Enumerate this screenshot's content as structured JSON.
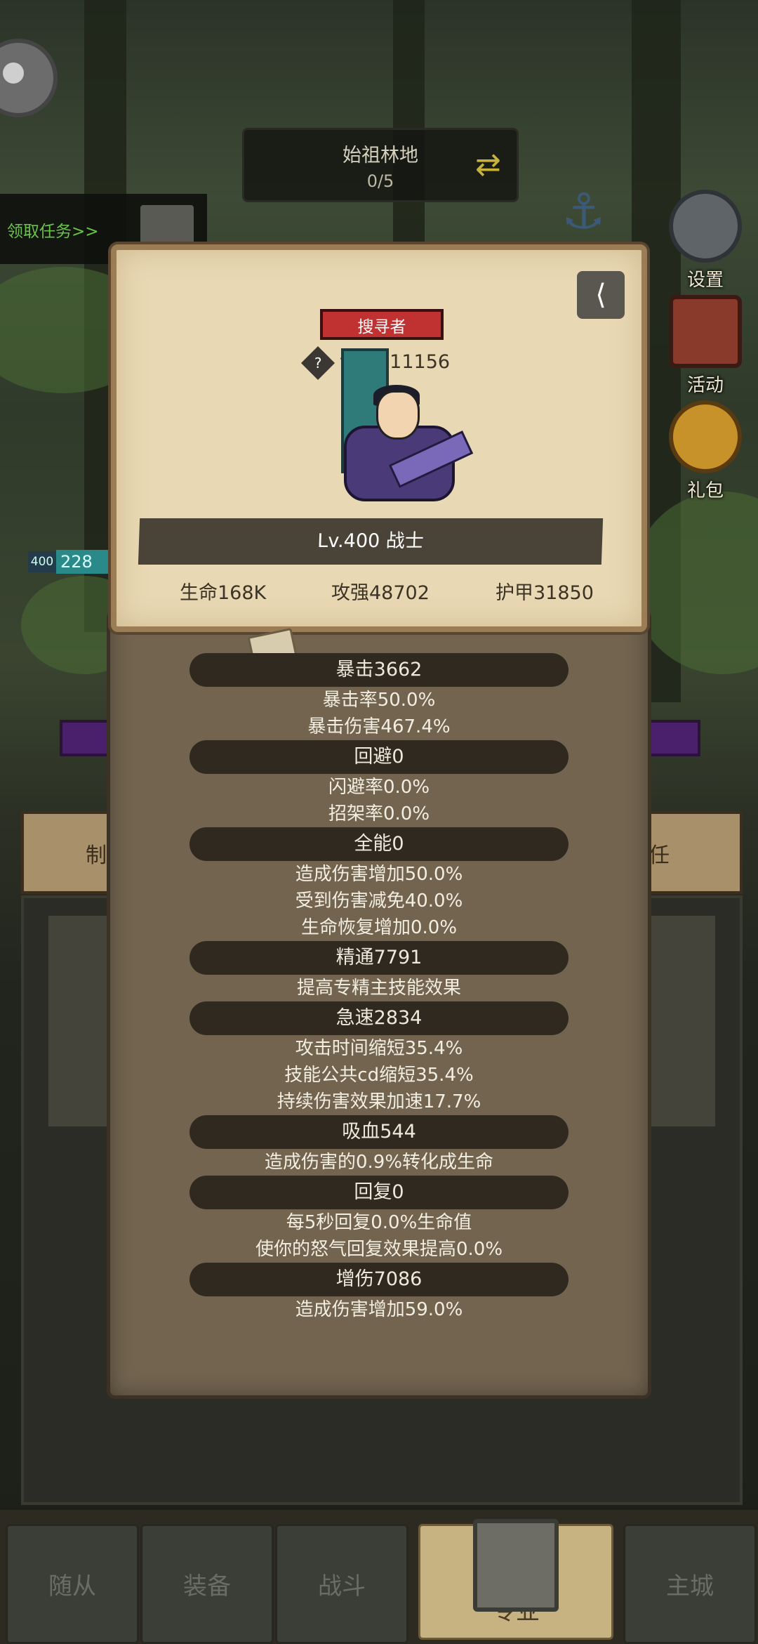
{
  "stage": {
    "name": "始祖林地",
    "progress": "0/5"
  },
  "task_link": "领取任务>>",
  "side_menu": [
    {
      "label": "设置",
      "icon": "gear-icon"
    },
    {
      "label": "活动",
      "icon": "scroll-icon"
    },
    {
      "label": "礼包",
      "icon": "gift-icon"
    }
  ],
  "hud": {
    "level_badge": "400",
    "bar_value": "228"
  },
  "background_tabs": {
    "left": "制",
    "right": "任"
  },
  "card": {
    "role_tag": "搜寻者",
    "score_label": "评分111156",
    "level_class": "Lv.400 战士",
    "hp": "生命168K",
    "attack": "攻强48702",
    "armor": "护甲31850"
  },
  "stats": [
    {
      "head": "暴击3662",
      "lines": [
        "暴击率50.0%",
        "暴击伤害467.4%"
      ]
    },
    {
      "head": "回避0",
      "lines": [
        "闪避率0.0%",
        "招架率0.0%"
      ]
    },
    {
      "head": "全能0",
      "lines": [
        "造成伤害增加50.0%",
        "受到伤害减免40.0%",
        "生命恢复增加0.0%"
      ]
    },
    {
      "head": "精通7791",
      "lines": [
        "提高专精主技能效果"
      ]
    },
    {
      "head": "急速2834",
      "lines": [
        "攻击时间缩短35.4%",
        "技能公共cd缩短35.4%",
        "持续伤害效果加速17.7%"
      ]
    },
    {
      "head": "吸血544",
      "lines": [
        "造成伤害的0.9%转化成生命"
      ]
    },
    {
      "head": "回复0",
      "lines": [
        "每5秒回复0.0%生命值",
        "使你的怒气回复效果提高0.0%"
      ]
    },
    {
      "head": "增伤7086",
      "lines": [
        "造成伤害增加59.0%"
      ]
    }
  ],
  "bottom_nav": [
    "随从",
    "装备",
    "战斗",
    "专业",
    "主城"
  ],
  "active_tab": "专业"
}
